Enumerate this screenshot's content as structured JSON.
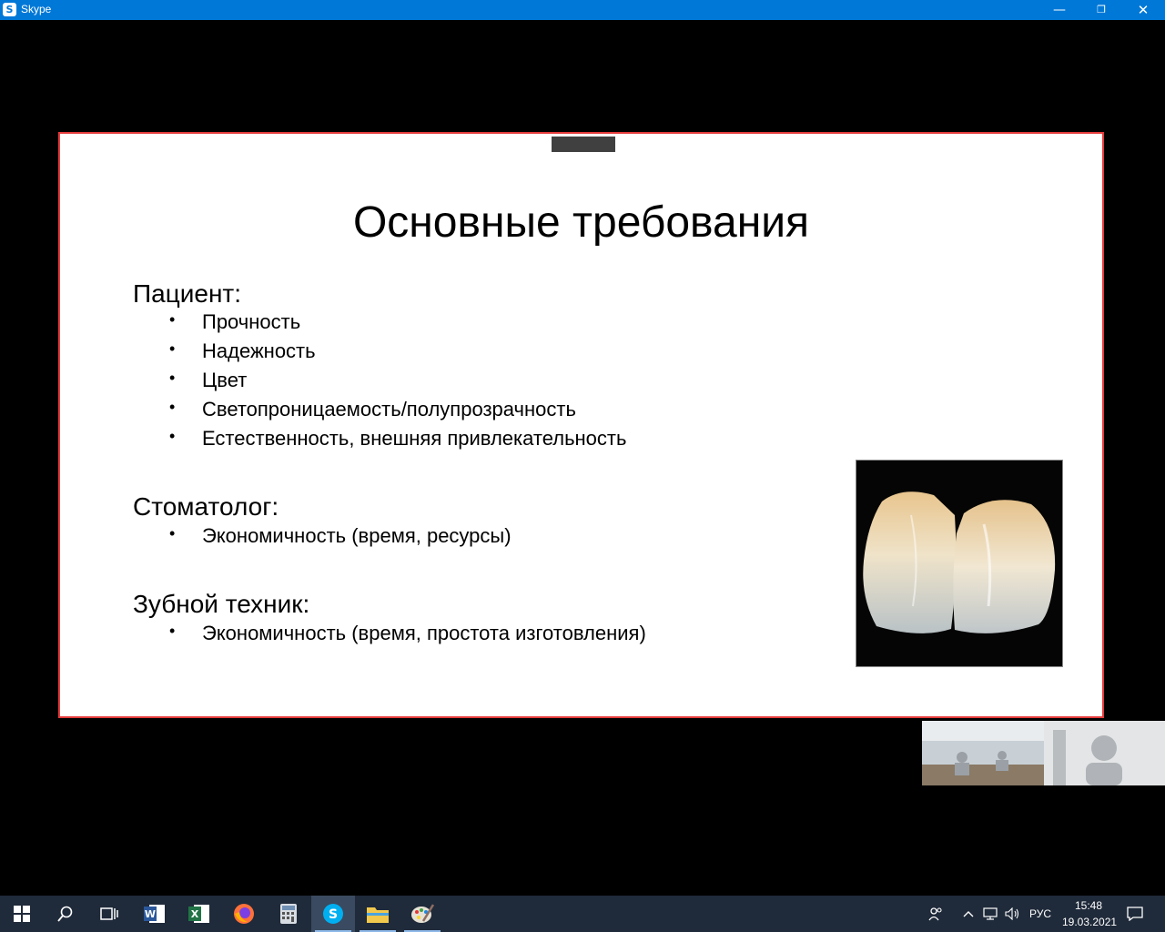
{
  "window": {
    "title": "Skype",
    "icon": "skype-icon",
    "controls": [
      "minimize-icon",
      "restore-icon",
      "close-icon"
    ]
  },
  "slide": {
    "title": "Основные требования",
    "sections": [
      {
        "heading": "Пациент:",
        "items": [
          "Прочность",
          "Надежность",
          "Цвет",
          "Светопроницаемость/полупрозрачность",
          "Естественность, внешняя привлекательность"
        ]
      },
      {
        "heading": "Стоматолог:",
        "items": [
          "Экономичность (время, ресурсы)"
        ]
      },
      {
        "heading": "Зубной техник:",
        "items": [
          "Экономичность (время, простота изготовления)"
        ]
      }
    ],
    "bullet": "•",
    "colors": {
      "border": "#e53b3b",
      "background": "#ffffff"
    }
  },
  "video_tiles": [
    "classroom-video",
    "presenter-video"
  ],
  "taskbar": {
    "apps": [
      "windows-start-icon",
      "search-icon",
      "task-view-icon",
      "word-icon",
      "excel-icon",
      "firefox-icon",
      "calculator-icon",
      "skype-icon",
      "file-explorer-icon",
      "paint-icon"
    ],
    "active_app": "skype-icon",
    "tray": {
      "language": "РУС",
      "time": "15:48",
      "date": "19.03.2021"
    }
  }
}
